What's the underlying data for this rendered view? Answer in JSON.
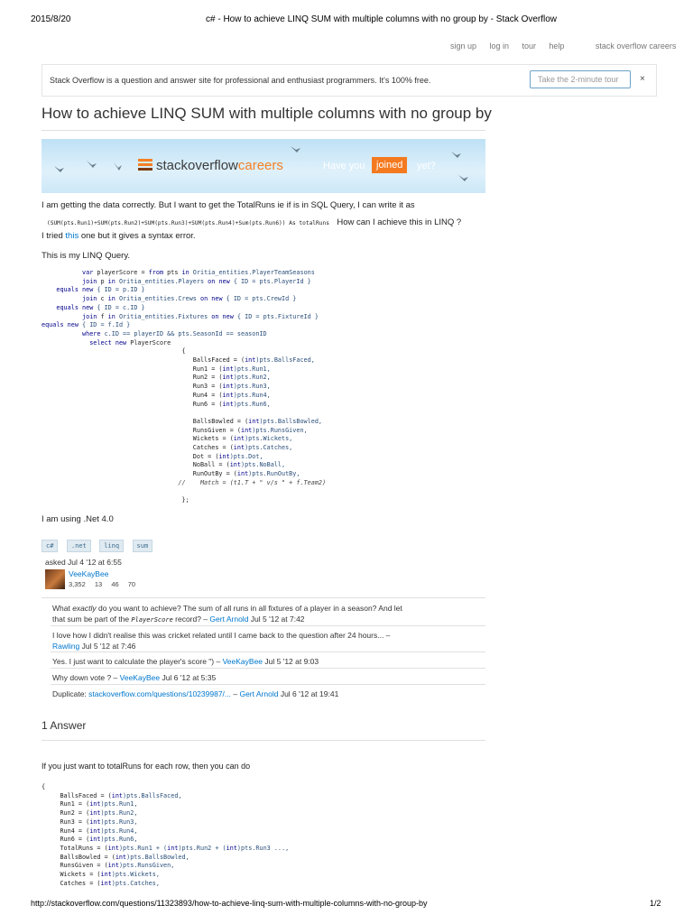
{
  "header": {
    "date": "2015/8/20",
    "title": "c# - How to achieve LINQ SUM with multiple columns with no group by - Stack Overflow"
  },
  "topnav": [
    "sign up",
    "log in",
    "tour",
    "help",
    "stack overflow careers"
  ],
  "banner": {
    "text": "Stack Overflow is a question and answer site for professional and enthusiast programmers. It's 100% free.",
    "tour_button": "Take the 2-minute tour",
    "close": "×"
  },
  "question": {
    "title": "How to achieve LINQ SUM with multiple columns with no group by",
    "careers_ad": {
      "logo_a": "stackoverflow",
      "logo_b": "careers",
      "have_you": "Have you",
      "joined": "joined",
      "yet": "yet?"
    },
    "p1": "I am getting the data correctly. But I want to get the TotalRuns ie if is in SQL Query, I can write it as",
    "p1_code": "(SUM(pts.Run1)+SUM(pts.Run2)+SUM(pts.Run3)+SUM(pts.Run4)+Sum(pts.Run6)) As totalRuns",
    "p1_tail": "How can I achieve this in LINQ ?",
    "p2_pre": "I tried ",
    "p2_link": "this",
    "p2_post": " one but it gives a syntax error.",
    "p3": "This is my LINQ Query.",
    "code_lines": [
      "           var playerScore = from pts in Oritia_entities.PlayerTeamSeasons",
      "           join p in Oritia_entities.Players on new { ID = pts.PlayerId }",
      "    equals new { ID = p.ID }",
      "           join c in Oritia_entities.Crews on new { ID = pts.CrewId }",
      "    equals new { ID = c.ID }",
      "           join f in Oritia_entities.Fixtures on new { ID = pts.FixtureId }",
      "equals new { ID = f.Id }",
      "           where c.ID == playerID && pts.SeasonId == seasonID",
      "             select new PlayerScore",
      "                                      {",
      "                                         BallsFaced = (int)pts.BallsFaced,",
      "                                         Run1 = (int)pts.Run1,",
      "                                         Run2 = (int)pts.Run2,",
      "                                         Run3 = (int)pts.Run3,",
      "                                         Run4 = (int)pts.Run4,",
      "                                         Run6 = (int)pts.Run6,",
      "",
      "                                         BallsBowled = (int)pts.BallsBowled,",
      "                                         RunsGiven = (int)pts.RunsGiven,",
      "                                         Wickets = (int)pts.Wickets,",
      "                                         Catches = (int)pts.Catches,",
      "                                         Dot = (int)pts.Dot,",
      "                                         NoBall = (int)pts.NoBall,",
      "                                         RunOutBy = (int)pts.RunOutBy,",
      "                                     //    Match = (t1.T + \" v/s \" + f.Team2)",
      "",
      "                                      };"
    ],
    "p4": "I am using .Net 4.0",
    "tags": [
      "c#",
      ".net",
      "linq",
      "sum"
    ],
    "asked": "asked Jul 4 '12 at 6:55",
    "user": {
      "name": "VeeKayBee",
      "rep": "3,352",
      "gold": "13",
      "silver": "46",
      "bronze": "70"
    },
    "comments": [
      {
        "line1_pre": "What ",
        "line1_em": "exactly",
        "line1_post": " do you want to achieve? The sum of all runs in all fixtures of a player in a season? And let",
        "line2_pre": "that sum be part of the ",
        "line2_code": "PlayerScore",
        "line2_post": " record? – ",
        "user": "Gert Arnold",
        "time": " Jul 5 '12 at 7:42"
      },
      {
        "line1": "I love how I didn't realise this was cricket related until I came back to the question after 24 hours... –",
        "user": "Rawling",
        "time": " Jul 5 '12 at 7:46"
      },
      {
        "text": "Yes. I just want to calculate the player's score \") – ",
        "user": "VeeKayBee",
        "time": "  Jul 5 '12 at 9:03"
      },
      {
        "text": "Why down vote ? – ",
        "user": "VeeKayBee",
        "time": "  Jul 6 '12 at 5:35"
      },
      {
        "text": "Duplicate: ",
        "link": "stackoverflow.com/questions/10239987/...",
        "sep": " – ",
        "user": "Gert Arnold",
        "time": " Jul 6 '12 at 19:41"
      }
    ]
  },
  "answers": {
    "count_label": "1 Answer",
    "intro": "If you just want to totalRuns for each row, then you can do",
    "code_lines": [
      "{",
      "     BallsFaced = (int)pts.BallsFaced,",
      "     Run1 = (int)pts.Run1,",
      "     Run2 = (int)pts.Run2,",
      "     Run3 = (int)pts.Run3,",
      "     Run4 = (int)pts.Run4,",
      "     Run6 = (int)pts.Run6,",
      "     TotalRuns = (int)pts.Run1 + (int)pts.Run2 + (int)pts.Run3 ...,",
      "     BallsBowled = (int)pts.BallsBowled,",
      "     RunsGiven = (int)pts.RunsGiven,",
      "     Wickets = (int)pts.Wickets,",
      "     Catches = (int)pts.Catches,"
    ]
  },
  "footer": {
    "url": "http://stackoverflow.com/questions/11323893/how-to-achieve-linq-sum-with-multiple-columns-with-no-group-by",
    "page": "1/2"
  }
}
